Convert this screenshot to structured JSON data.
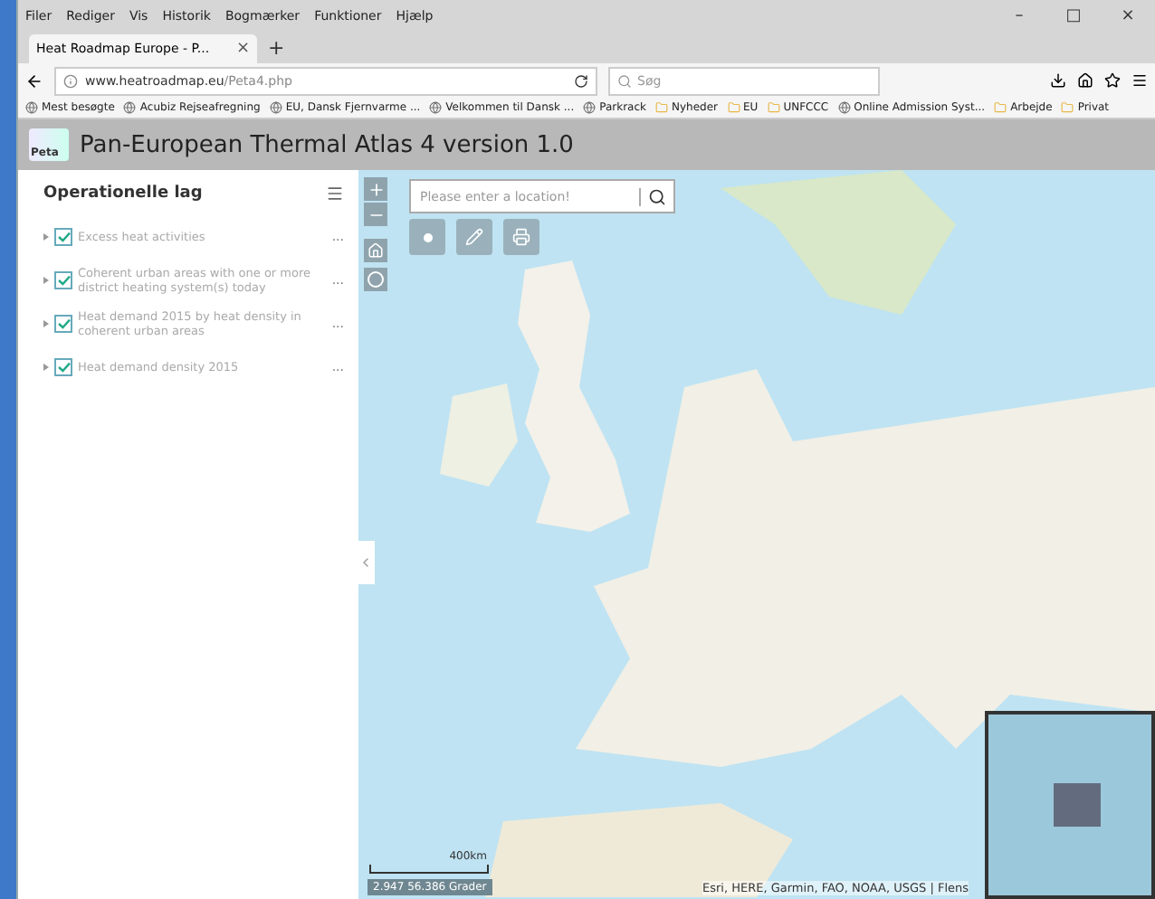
{
  "menu_bar": [
    "Filer",
    "Rediger",
    "Vis",
    "Historik",
    "Bogmærker",
    "Funktioner",
    "Hjælp"
  ],
  "window_controls": [
    "–",
    "□",
    "×"
  ],
  "tabs": [
    {
      "title": "Heat Roadmap Europe - P...",
      "close": "×",
      "selected": true
    }
  ],
  "new_tab": "+",
  "address_bar": {
    "domain": "www.heatroadmap.eu",
    "path": "/Peta4.php",
    "search_placeholder": "Søg"
  },
  "bookmarks": [
    {
      "label": "Mest besøgte",
      "kind": "site"
    },
    {
      "label": "Acubiz Rejseafregning",
      "kind": "site"
    },
    {
      "label": "EU, Dansk Fjernvarme ...",
      "kind": "site"
    },
    {
      "label": "Velkommen til Dansk ...",
      "kind": "site"
    },
    {
      "label": "Parkrack",
      "kind": "site"
    },
    {
      "label": "Nyheder",
      "kind": "folder"
    },
    {
      "label": "EU",
      "kind": "folder"
    },
    {
      "label": "UNFCCC",
      "kind": "folder"
    },
    {
      "label": "Online Admission Syst...",
      "kind": "site"
    },
    {
      "label": "Arbejde",
      "kind": "folder"
    },
    {
      "label": "Privat",
      "kind": "folder"
    }
  ],
  "app": {
    "logo": "Peta",
    "title": "Pan-European Thermal Atlas 4 version 1.0"
  },
  "layers_panel": {
    "title": "Operationelle lag",
    "layers": [
      {
        "name": "Excess heat activities",
        "checked": true,
        "more": "..."
      },
      {
        "name": "Coherent urban areas with one or more district heating system(s) today",
        "checked": true,
        "more": "..."
      },
      {
        "name": "Heat demand 2015 by heat density in coherent urban areas",
        "checked": true,
        "more": "..."
      },
      {
        "name": "Heat demand density 2015",
        "checked": true,
        "more": "..."
      }
    ]
  },
  "map": {
    "search_placeholder": "Please enter a location!",
    "scale": "400km",
    "coordinates": "2.947 56.386 Grader",
    "attribution": "Esri, HERE, Garmin, FAO, NOAA, USGS | Flens"
  }
}
